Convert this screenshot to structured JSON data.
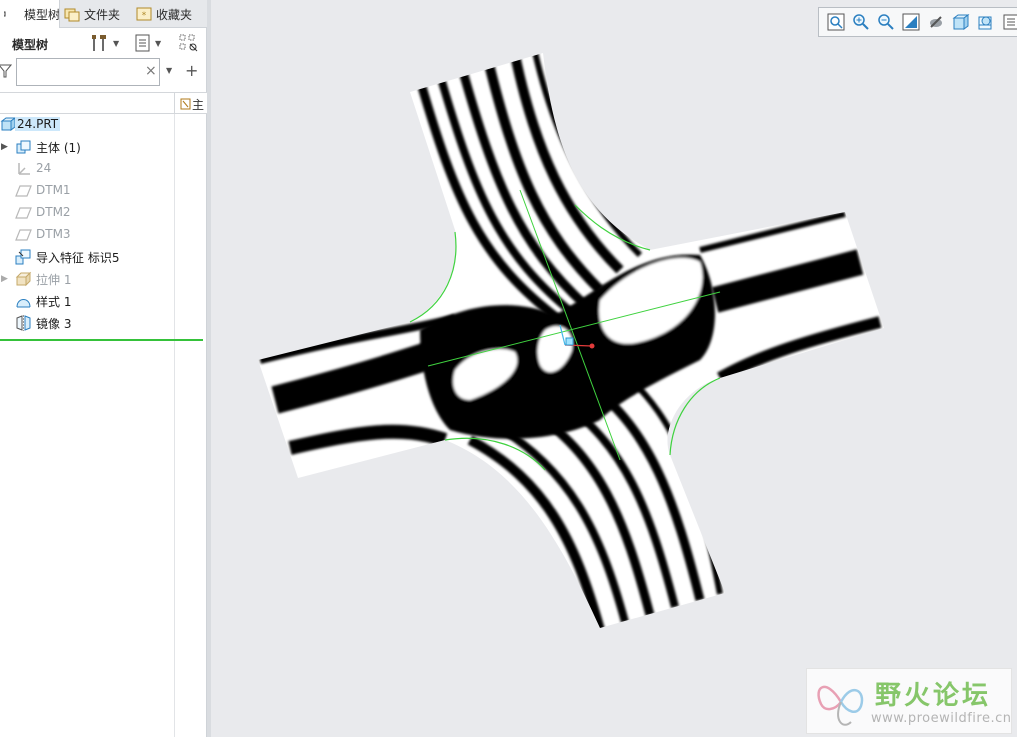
{
  "tabs": [
    {
      "label": "模型树",
      "active": true
    },
    {
      "label": "文件夹",
      "active": false
    },
    {
      "label": "收藏夹",
      "active": false
    }
  ],
  "panel": {
    "title": "模型树",
    "filter_value": "",
    "column_header": "主"
  },
  "tree": [
    {
      "label": "24.PRT",
      "icon": "part-icon",
      "dim": false,
      "expand": false,
      "root": true
    },
    {
      "label": "主体 (1)",
      "icon": "body-icon",
      "dim": false,
      "expand": true
    },
    {
      "label": "24",
      "icon": "csys-icon",
      "dim": true,
      "expand": false
    },
    {
      "label": "DTM1",
      "icon": "datum-plane-icon",
      "dim": true,
      "expand": false
    },
    {
      "label": "DTM2",
      "icon": "datum-plane-icon",
      "dim": true,
      "expand": false
    },
    {
      "label": "DTM3",
      "icon": "datum-plane-icon",
      "dim": true,
      "expand": false
    },
    {
      "label": "导入特征 标识5",
      "icon": "import-feature-icon",
      "dim": false,
      "expand": false
    },
    {
      "label": "拉伸 1",
      "icon": "extrude-icon",
      "dim": true,
      "expand": true
    },
    {
      "label": "样式 1",
      "icon": "style-icon",
      "dim": false,
      "expand": false
    },
    {
      "label": "镜像 3",
      "icon": "mirror-icon",
      "dim": false,
      "expand": false
    }
  ],
  "view_toolbar": [
    "refit-icon",
    "zoom-in-icon",
    "zoom-out-icon",
    "repaint-icon",
    "display-style-icon",
    "saved-views-icon",
    "view-manager-icon",
    "more-icon"
  ],
  "watermark": {
    "title": "野火论坛",
    "url": "www.proewildfire.cn"
  },
  "colors": {
    "accent": "#35c23a",
    "selection": "#cde8fb",
    "background": "#e9eaed"
  }
}
